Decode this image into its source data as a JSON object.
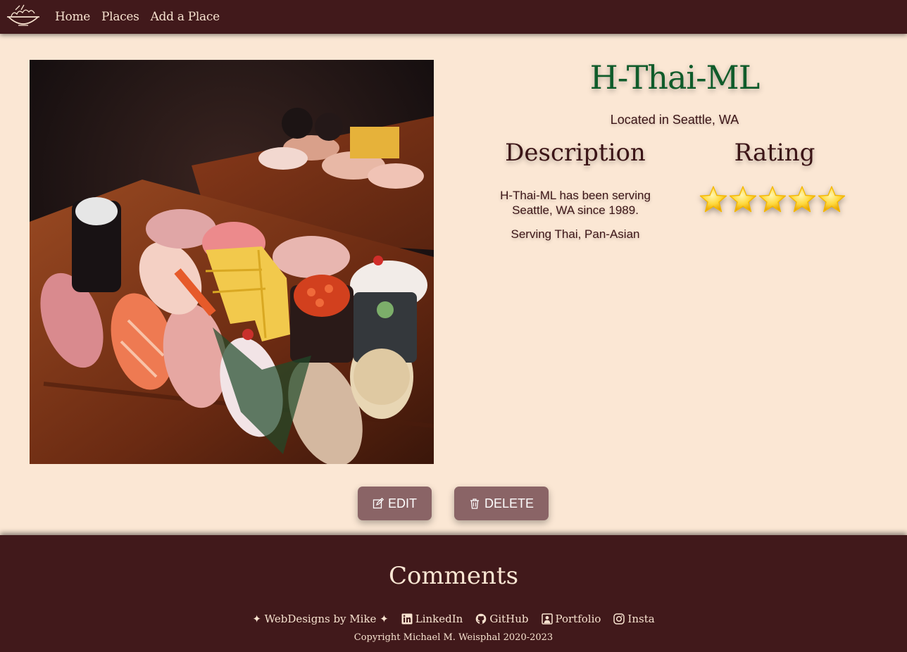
{
  "nav": {
    "logo_icon": "food-bowl-icon",
    "links": [
      "Home",
      "Places",
      "Add a Place"
    ]
  },
  "place": {
    "name": "H-Thai-ML",
    "location": "Located in Seattle, WA",
    "description_heading": "Description",
    "rating_heading": "Rating",
    "description": "H-Thai-ML has been serving Seattle, WA since 1989.",
    "cuisines": "Serving Thai, Pan-Asian",
    "rating_stars": 5,
    "rating_max": 5,
    "image_icon": "sushi-platter-photo"
  },
  "actions": {
    "edit_label": "EDIT",
    "delete_label": "DELETE"
  },
  "footer": {
    "comments_title": "Comments",
    "brand": "✦ WebDesigns by Mike ✦",
    "links": [
      "LinkedIn",
      "GitHub",
      "Portfolio",
      "Insta"
    ],
    "copyright": "Copyright Michael M. Weisphal 2020-2023"
  },
  "colors": {
    "nav_bg": "#41191b",
    "page_bg": "#fbe7d4",
    "title_green": "#0f5b2a",
    "button_bg": "#8a6466",
    "star_gold": "#f5b800"
  }
}
